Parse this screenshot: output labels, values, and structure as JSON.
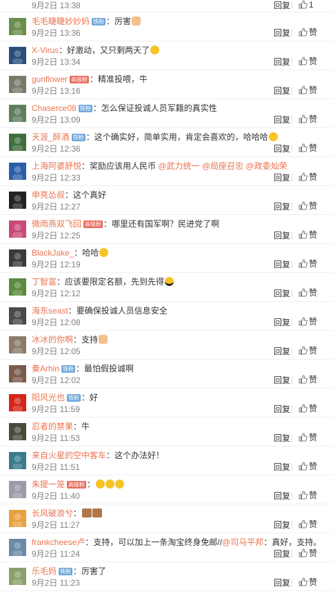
{
  "actions": {
    "reply": "回复",
    "like": "赞"
  },
  "top_partial": {
    "time": "9月2日 13:38",
    "reply": "回复",
    "like_count": "1"
  },
  "comments": [
    {
      "name": "毛毛睫睫妙妙妈",
      "badge": "铁粉",
      "badge_type": "fan",
      "text": "：厉害",
      "emoji": "hand",
      "time": "9月2日 13:36",
      "avatar": "#6b8e4e"
    },
    {
      "name": "X-Virus",
      "badge": "",
      "badge_type": "",
      "text": "：好激动，又只剩两天了",
      "emoji": "face",
      "time": "9月2日 13:34",
      "avatar": "#2a4d7a"
    },
    {
      "name": "gunflower",
      "badge": "高级粉",
      "badge_type": "vip",
      "text": "：精准投喂，牛",
      "emoji": "",
      "time": "9月2日 13:16",
      "avatar": "#7a7a6a"
    },
    {
      "name": "Chaserce08",
      "badge": "铁粉",
      "badge_type": "fan",
      "text": "：怎么保证投诚人员军籍的真实性",
      "emoji": "",
      "time": "9月2日 13:09",
      "avatar": "#5f7f5f"
    },
    {
      "name": "天涯_醉酒",
      "badge": "铁粉",
      "badge_type": "fan",
      "text": "：这个确实好，简单实用，肯定会喜欢的，哈哈哈",
      "emoji": "face",
      "time": "9月2日 12:36",
      "avatar": "#3f6f3f"
    },
    {
      "name": "上海阿婆舒悦",
      "badge": "",
      "badge_type": "",
      "text": "：奖励应该用人民币 ",
      "mentions": "@武力统一 @局座召忠 @政委灿荣",
      "emoji": "",
      "time": "9月2日 12:33",
      "avatar": "#2a5fa8"
    },
    {
      "name": "申亮怂叔",
      "badge": "",
      "badge_type": "",
      "text": "：这个真好",
      "emoji": "",
      "time": "9月2日 12:27",
      "avatar": "#222222"
    },
    {
      "name": "微雨燕双飞回",
      "badge": "高级粉",
      "badge_type": "vip",
      "text": "：哪里还有国军啊？民进党了啊",
      "emoji": "",
      "time": "9月2日 12:25",
      "avatar": "#c84a7a"
    },
    {
      "name": "BlackJake_",
      "badge": "",
      "badge_type": "",
      "text": "：哈哈",
      "emoji": "face",
      "time": "9月2日 12:19",
      "avatar": "#3a3a3a"
    },
    {
      "name": "丁智富",
      "badge": "",
      "badge_type": "",
      "text": "：应该要限定名额，先到先得",
      "emoji": "sunglass",
      "time": "9月2日 12:12",
      "avatar": "#5a8a3a"
    },
    {
      "name": "海东seast",
      "badge": "",
      "badge_type": "",
      "text": "：要确保投诚人员信息安全",
      "emoji": "",
      "time": "9月2日 12:08",
      "avatar": "#4a4a4a"
    },
    {
      "name": "冰冰的你啊",
      "badge": "",
      "badge_type": "",
      "text": "：支持",
      "emoji": "hand",
      "time": "9月2日 12:05",
      "avatar": "#8a7a6a"
    },
    {
      "name": "秦Arhin",
      "badge": "铁粉",
      "badge_type": "fan",
      "text": "：最怕假投诚啊",
      "emoji": "",
      "time": "9月2日 12:02",
      "avatar": "#7a5a4a"
    },
    {
      "name": "阳风光也",
      "badge": "铁粉",
      "badge_type": "fan",
      "text": "：好",
      "emoji": "",
      "time": "9月2日 11:59",
      "avatar": "#d62418"
    },
    {
      "name": "忍者的禁果",
      "badge": "",
      "badge_type": "",
      "text": "：牛",
      "emoji": "",
      "time": "9月2日 11:53",
      "avatar": "#4a4a3a"
    },
    {
      "name": "来自火星的空中客车",
      "badge": "",
      "badge_type": "",
      "text": "：这个办法好！",
      "emoji": "",
      "time": "9月2日 11:51",
      "avatar": "#3a7a8a"
    },
    {
      "name": "朱提一笼",
      "badge": "高级粉",
      "badge_type": "vip",
      "text": "：",
      "emoji": "face3",
      "time": "9月2日 11:40",
      "avatar": "#9a9aa8"
    },
    {
      "name": "长风破浪兮",
      "badge": "",
      "badge_type": "",
      "text": "：",
      "emoji": "people",
      "time": "9月2日 11:27",
      "avatar": "#e8a040"
    },
    {
      "name": "frankcheese卢",
      "badge": "",
      "badge_type": "",
      "text": "：支持，可以加上一条淘宝终身免邮//",
      "mentions": "@司马平邦",
      "text2": "：真好，支持。",
      "emoji": "",
      "time": "9月2日 11:24",
      "avatar": "#6a8aa8"
    },
    {
      "name": "乐毛妈",
      "badge": "铁粉",
      "badge_type": "fan",
      "text": "：厉害了",
      "emoji": "",
      "time": "9月2日 11:23",
      "avatar": "#8aa06a"
    }
  ]
}
